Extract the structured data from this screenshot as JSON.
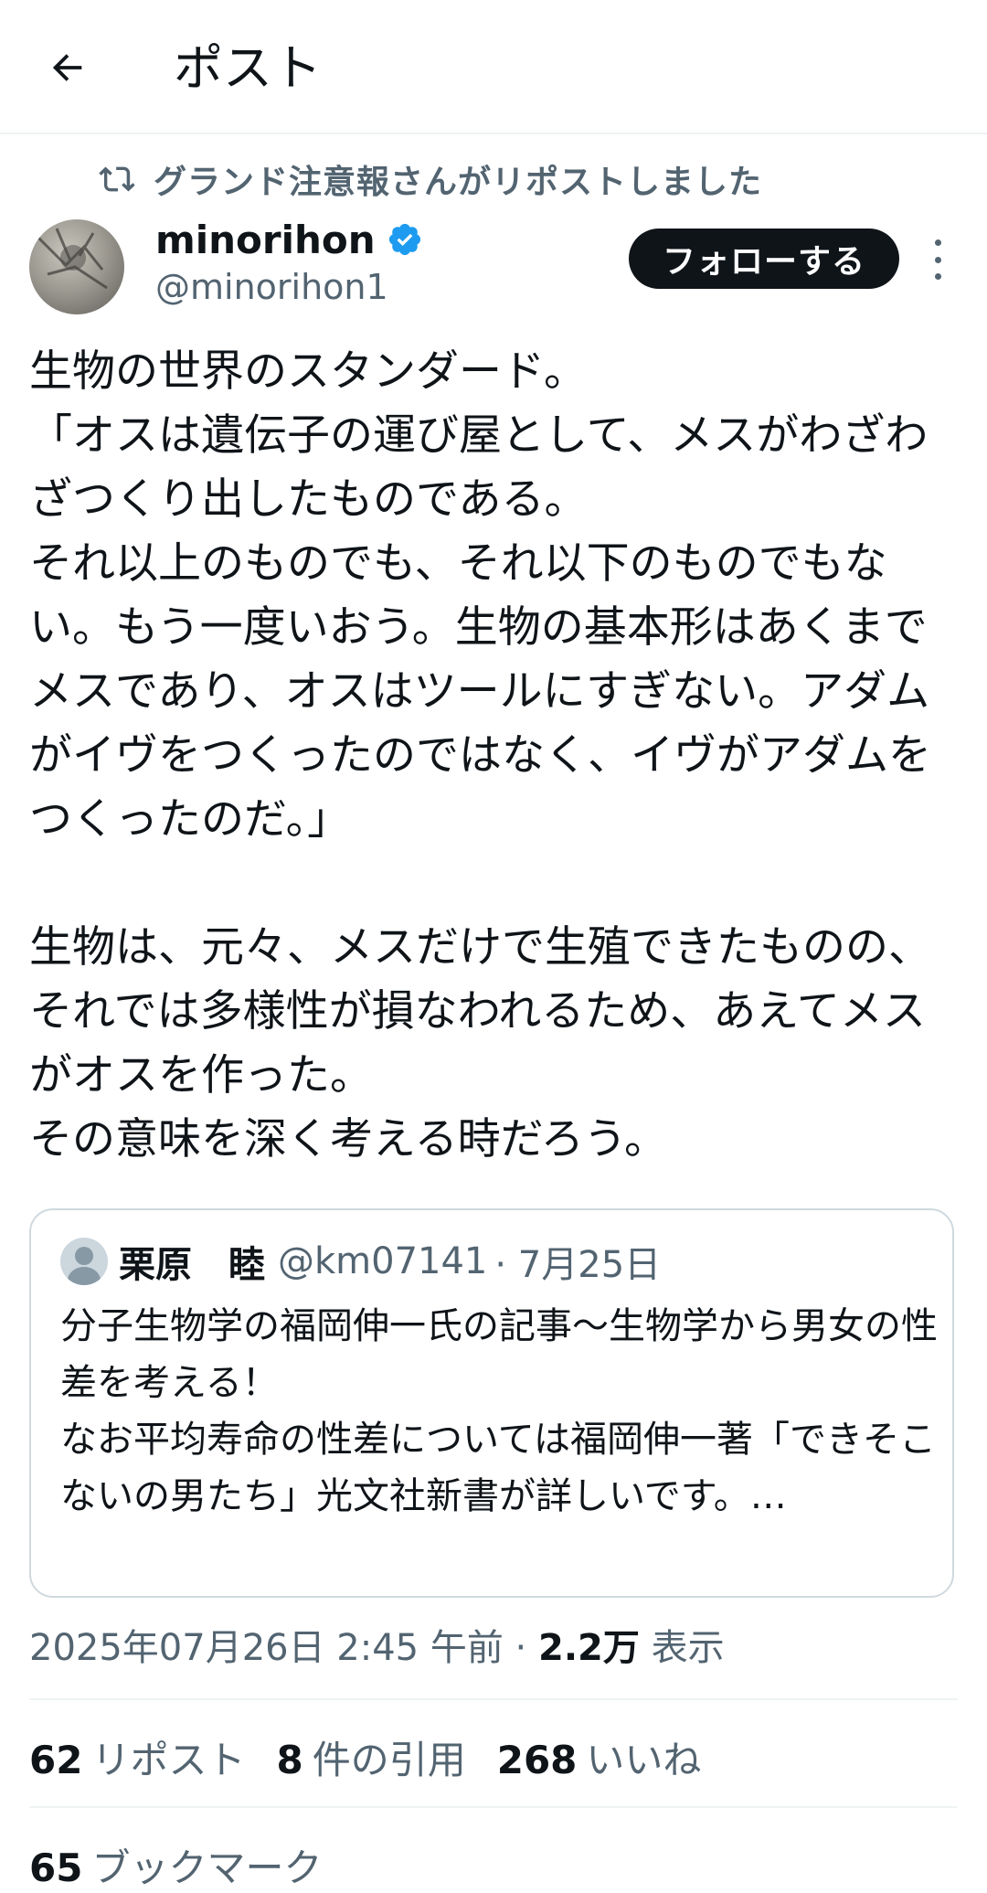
{
  "header": {
    "title": "ポスト",
    "back_icon": "arrow-left-icon"
  },
  "repost": {
    "icon": "repost-icon",
    "text": "グランド注意報さんがリポストしました"
  },
  "author": {
    "name": "minorihon",
    "handle": "@minorihon1",
    "verified_color": "#1d9bf0"
  },
  "follow_label": "フォローする",
  "post": {
    "text": "生物の世界のスタンダード。\n「オスは遺伝子の運び屋として、メスがわざわざつくり出したものである。\nそれ以上のものでも、それ以下のものでもない。もう一度いおう。生物の基本形はあくまでメスであり、オスはツールにすぎない。アダムがイヴをつくったのではなく、イヴがアダムをつくったのだ。」\n\n生物は、元々、メスだけで生殖できたものの、それでは多様性が損なわれるため、あえてメスがオスを作った。\nその意味を深く考える時だろう。"
  },
  "quote": {
    "name": "栗原　睦",
    "handle": "@km07141",
    "date": "· 7月25日",
    "text": "分子生物学の福岡伸一氏の記事～生物学から男女の性差を考える！\nなお平均寿命の性差については福岡伸一著「できそこないの男たち」光文社新書が詳しいです。…"
  },
  "meta": {
    "timestamp": "2025年07月26日 2:45 午前 ·",
    "views_count": "2.2万",
    "views_label": "表示"
  },
  "stats": {
    "reposts_count": "62",
    "reposts_label": "リポスト",
    "quotes_count": "8",
    "quotes_label": "件の引用",
    "likes_count": "268",
    "likes_label": "いいね",
    "bookmarks_count": "65",
    "bookmarks_label": "ブックマーク"
  },
  "colors": {
    "text": "#0f1419",
    "secondary": "#536471",
    "border": "#cfd9de",
    "accent": "#1d9bf0"
  }
}
